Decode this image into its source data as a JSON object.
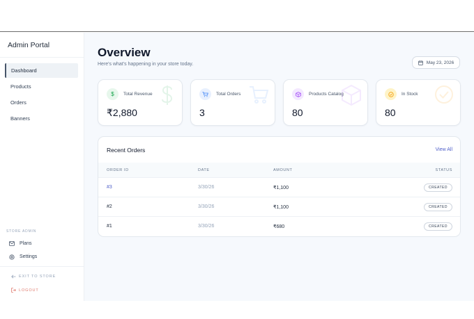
{
  "sidebar": {
    "brand": "Admin Portal",
    "items": [
      {
        "label": "Dashboard",
        "active": true
      },
      {
        "label": "Products"
      },
      {
        "label": "Orders"
      },
      {
        "label": "Banners"
      }
    ],
    "section_label": "STORE ADMIN",
    "sub_items": [
      {
        "label": "Plans",
        "icon": "envelope-icon"
      },
      {
        "label": "Settings",
        "icon": "gear-icon"
      }
    ],
    "exit_label": "EXIT TO STORE",
    "logout_label": "LOGOUT"
  },
  "header": {
    "title": "Overview",
    "subtitle": "Here's what's happening in your store today.",
    "date": "May 23, 2026"
  },
  "stats": [
    {
      "label": "Total Revenue",
      "value": "₹2,880",
      "icon": "dollar-icon",
      "color": "#16a34a"
    },
    {
      "label": "Total Orders",
      "value": "3",
      "icon": "cart-icon",
      "color": "#3b82f6"
    },
    {
      "label": "Products Catalog",
      "value": "80",
      "icon": "box-icon",
      "color": "#a855f7"
    },
    {
      "label": "In Stock",
      "value": "80",
      "icon": "check-circle-icon",
      "color": "#f59e0b"
    }
  ],
  "orders": {
    "title": "Recent Orders",
    "view_all": "View All",
    "columns": [
      "ORDER ID",
      "DATE",
      "AMOUNT",
      "STATUS"
    ],
    "rows": [
      {
        "id": "#3",
        "date": "3/30/26",
        "amount": "₹1,100",
        "status": "CREATED"
      },
      {
        "id": "#2",
        "date": "3/30/26",
        "amount": "₹1,100",
        "status": "CREATED"
      },
      {
        "id": "#1",
        "date": "3/30/26",
        "amount": "₹680",
        "status": "CREATED"
      }
    ]
  }
}
